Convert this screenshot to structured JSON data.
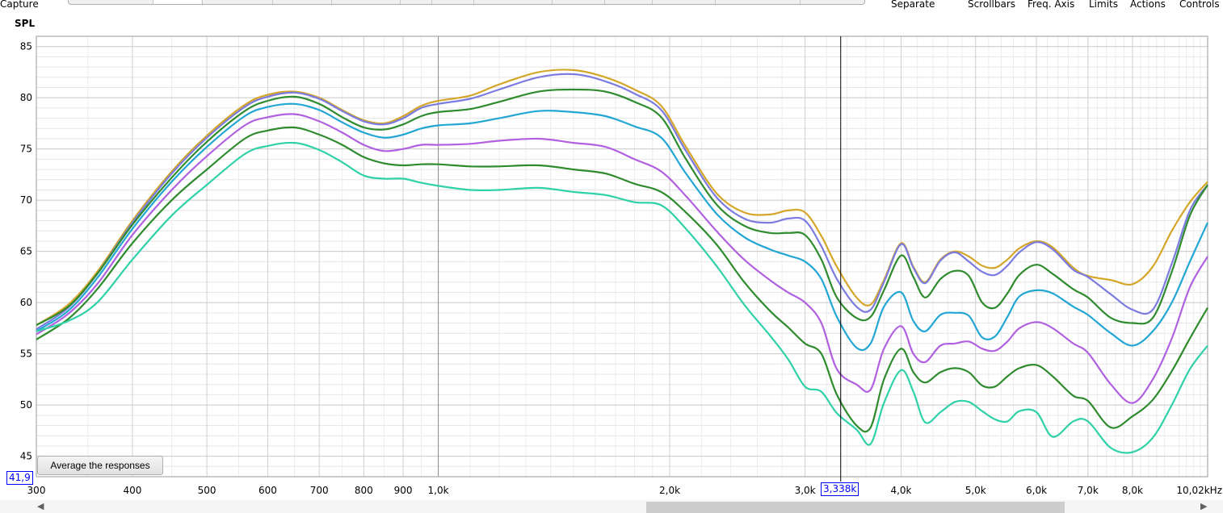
{
  "toolbar": {
    "capture_label": "Capture",
    "menu": [
      "Separate",
      "Scrollbars",
      "Freq. Axis",
      "Limits",
      "Actions",
      "Controls"
    ]
  },
  "plot": {
    "y_axis_label": "SPL",
    "average_button_label": "Average the responses",
    "cursor": {
      "frequency_label": "3,338k",
      "level_label": "41,9",
      "frequency_hz": 3338
    }
  },
  "chart_data": {
    "type": "line",
    "xscale": "log",
    "xlim": [
      300,
      10020
    ],
    "ylim": [
      43,
      86
    ],
    "grid": true,
    "y_ticks": [
      45,
      50,
      55,
      60,
      65,
      70,
      75,
      80,
      85
    ],
    "x_ticks": [
      {
        "value": 300,
        "label": "300"
      },
      {
        "value": 400,
        "label": "400"
      },
      {
        "value": 500,
        "label": "500"
      },
      {
        "value": 600,
        "label": "600"
      },
      {
        "value": 700,
        "label": "700"
      },
      {
        "value": 800,
        "label": "800"
      },
      {
        "value": 900,
        "label": "900"
      },
      {
        "value": 1000,
        "label": "1,0k"
      },
      {
        "value": 2000,
        "label": "2,0k"
      },
      {
        "value": 3000,
        "label": "3,0k"
      },
      {
        "value": 4000,
        "label": "4,0k"
      },
      {
        "value": 5000,
        "label": "5,0k"
      },
      {
        "value": 6000,
        "label": "6,0k"
      },
      {
        "value": 7000,
        "label": "7,0k"
      },
      {
        "value": 8000,
        "label": "8,0k"
      },
      {
        "value": 10020,
        "label": "10,02kHz"
      }
    ],
    "x": [
      300,
      330,
      360,
      400,
      450,
      500,
      560,
      600,
      650,
      700,
      750,
      800,
      850,
      900,
      950,
      1000,
      1100,
      1200,
      1350,
      1500,
      1650,
      1800,
      1950,
      2100,
      2300,
      2500,
      2700,
      2850,
      3000,
      3150,
      3300,
      3500,
      3650,
      3800,
      4000,
      4150,
      4300,
      4500,
      4700,
      4900,
      5100,
      5300,
      5500,
      5700,
      6000,
      6300,
      6700,
      7000,
      7500,
      8000,
      8500,
      9000,
      9500,
      10020
    ],
    "series": [
      {
        "color": "#d4a62a",
        "values": [
          57.8,
          59.8,
          63.0,
          68.0,
          72.8,
          76.3,
          79.3,
          80.3,
          80.6,
          80.0,
          78.8,
          77.8,
          77.5,
          78.2,
          79.2,
          79.7,
          80.2,
          81.3,
          82.5,
          82.7,
          82.0,
          80.8,
          79.2,
          75.2,
          70.7,
          68.8,
          68.6,
          69.0,
          68.8,
          66.5,
          63.5,
          60.5,
          59.8,
          62.2,
          65.8,
          63.5,
          62.0,
          64.2,
          65.0,
          64.5,
          63.6,
          63.4,
          64.2,
          65.3,
          66.0,
          65.4,
          63.4,
          62.6,
          62.2,
          61.8,
          63.5,
          67.0,
          69.8,
          71.8
        ]
      },
      {
        "color": "#7b7be0",
        "values": [
          57.4,
          59.5,
          62.8,
          67.8,
          72.6,
          76.1,
          79.1,
          80.1,
          80.5,
          79.9,
          78.7,
          77.7,
          77.4,
          78.0,
          79.0,
          79.4,
          79.9,
          80.8,
          82.0,
          82.3,
          81.6,
          80.4,
          78.8,
          74.8,
          70.3,
          68.2,
          67.8,
          68.2,
          68.0,
          65.5,
          62.3,
          59.6,
          59.3,
          62.0,
          65.7,
          63.4,
          61.9,
          64.1,
          64.9,
          64.0,
          63.0,
          62.7,
          63.6,
          64.9,
          65.9,
          65.2,
          63.2,
          62.5,
          60.8,
          59.3,
          59.3,
          63.8,
          69.0,
          71.5
        ]
      },
      {
        "color": "#2e8b2e",
        "values": [
          57.8,
          59.6,
          62.8,
          67.6,
          72.2,
          75.7,
          78.7,
          79.7,
          80.1,
          79.4,
          78.1,
          77.1,
          76.9,
          77.4,
          78.2,
          78.6,
          78.9,
          79.6,
          80.6,
          80.8,
          80.6,
          79.6,
          78.1,
          74.0,
          69.6,
          67.5,
          66.8,
          66.8,
          66.6,
          64.2,
          60.5,
          58.5,
          58.6,
          61.2,
          64.6,
          62.5,
          60.5,
          62.3,
          63.1,
          62.6,
          60.0,
          59.5,
          60.9,
          62.7,
          63.7,
          62.8,
          61.3,
          60.5,
          58.5,
          58.0,
          58.5,
          63.0,
          68.5,
          71.5
        ]
      },
      {
        "color": "#22a6d4",
        "values": [
          57.2,
          59.2,
          62.4,
          67.2,
          71.8,
          75.2,
          78.2,
          79.1,
          79.4,
          78.8,
          77.6,
          76.6,
          76.1,
          76.4,
          77.0,
          77.3,
          77.5,
          78.0,
          78.7,
          78.6,
          78.2,
          77.2,
          76.1,
          72.6,
          68.7,
          66.4,
          65.2,
          64.6,
          64.0,
          62.3,
          58.6,
          55.6,
          56.0,
          59.6,
          61.0,
          58.2,
          57.2,
          58.8,
          59.0,
          58.7,
          56.6,
          56.7,
          58.6,
          60.6,
          61.2,
          60.9,
          59.6,
          58.8,
          57.0,
          55.8,
          57.2,
          60.0,
          64.0,
          67.8
        ]
      },
      {
        "color": "#b060e0",
        "values": [
          56.9,
          58.9,
          61.8,
          66.6,
          71.0,
          74.3,
          77.3,
          78.1,
          78.4,
          77.7,
          76.6,
          75.4,
          74.8,
          75.0,
          75.4,
          75.4,
          75.5,
          75.8,
          76.0,
          75.6,
          75.2,
          74.0,
          72.8,
          70.4,
          67.0,
          64.2,
          62.2,
          61.0,
          60.0,
          58.0,
          53.5,
          52.0,
          51.5,
          55.5,
          57.7,
          55.0,
          54.2,
          55.8,
          56.0,
          56.2,
          55.5,
          55.3,
          56.2,
          57.5,
          58.1,
          57.5,
          56.0,
          55.1,
          52.0,
          50.2,
          52.5,
          56.5,
          61.5,
          64.5
        ]
      },
      {
        "color": "#2e8b2e",
        "values": [
          56.4,
          58.4,
          61.3,
          65.8,
          70.0,
          73.0,
          76.0,
          76.8,
          77.1,
          76.4,
          75.4,
          74.2,
          73.6,
          73.4,
          73.5,
          73.5,
          73.3,
          73.3,
          73.4,
          73.0,
          72.6,
          71.6,
          70.8,
          68.8,
          65.7,
          62.0,
          59.2,
          57.6,
          56.0,
          55.0,
          51.0,
          48.0,
          47.8,
          52.5,
          55.5,
          53.2,
          52.2,
          53.2,
          53.6,
          53.2,
          51.9,
          51.8,
          52.8,
          53.6,
          53.9,
          52.8,
          50.9,
          50.4,
          47.8,
          48.9,
          50.5,
          53.3,
          56.5,
          59.5
        ]
      },
      {
        "color": "#2fd1a8",
        "values": [
          57.2,
          58.2,
          60.0,
          64.2,
          68.5,
          71.5,
          74.5,
          75.3,
          75.6,
          74.9,
          73.7,
          72.4,
          72.1,
          72.1,
          71.7,
          71.4,
          71.0,
          71.0,
          71.2,
          70.8,
          70.5,
          69.8,
          69.5,
          67.2,
          63.6,
          59.8,
          56.8,
          54.5,
          51.8,
          51.3,
          49.2,
          47.6,
          46.2,
          50.2,
          53.4,
          51.3,
          48.3,
          49.3,
          50.3,
          50.3,
          49.4,
          48.6,
          48.4,
          49.4,
          49.3,
          46.9,
          48.4,
          48.4,
          45.8,
          45.4,
          46.8,
          50.0,
          53.5,
          55.8
        ]
      }
    ]
  }
}
